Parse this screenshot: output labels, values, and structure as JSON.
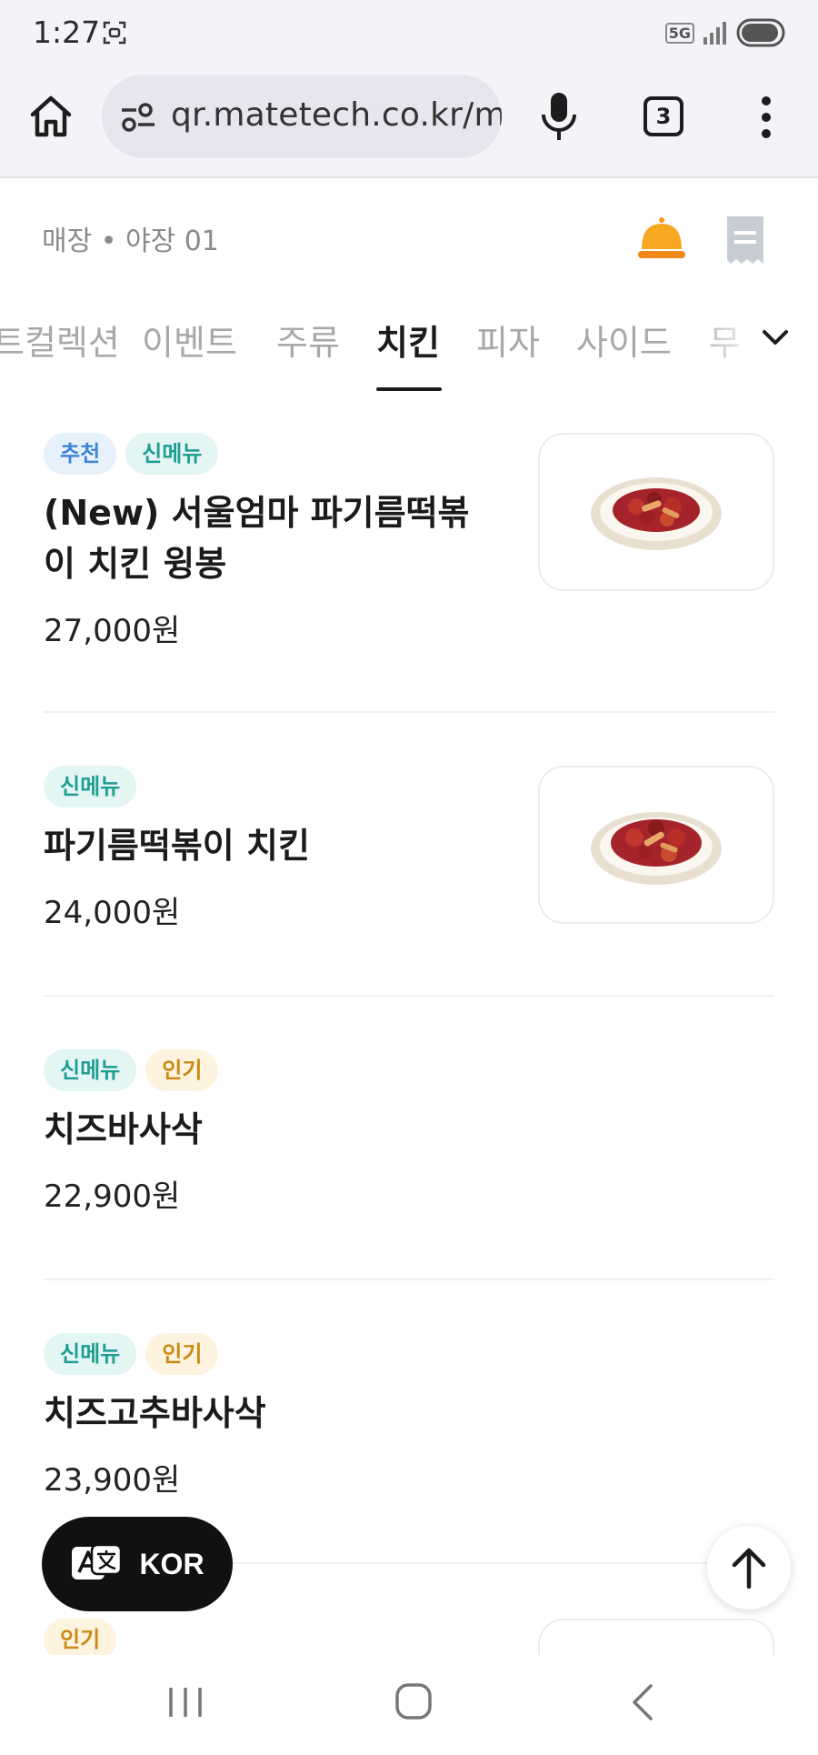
{
  "status_bar": {
    "time": "1:27",
    "network": "5G"
  },
  "browser": {
    "url": "qr.matetech.co.kr/me",
    "tab_count": "3"
  },
  "header": {
    "store": "매장 • 야장 01"
  },
  "categories": [
    "트컬렉션",
    "이벤트",
    "주류",
    "치킨",
    "피자",
    "사이드",
    "무"
  ],
  "active_category": "치킨",
  "items": [
    {
      "badges": [
        "추천",
        "신메뉴"
      ],
      "name": "(New) 서울엄마 파기름떡볶이 치킨 윙봉",
      "price": "27,000원",
      "has_image": true
    },
    {
      "badges": [
        "신메뉴"
      ],
      "name": "파기름떡볶이 치킨",
      "price": "24,000원",
      "has_image": true
    },
    {
      "badges": [
        "신메뉴",
        "인기"
      ],
      "name": "치즈바사삭",
      "price": "22,900원",
      "has_image": false
    },
    {
      "badges": [
        "신메뉴",
        "인기"
      ],
      "name": "치즈고추바사삭",
      "price": "23,900원",
      "has_image": false
    },
    {
      "badges": [
        "인기"
      ],
      "name": "",
      "price": "",
      "has_image": true
    }
  ],
  "language_button": {
    "label": "KOR"
  },
  "colors": {
    "accent_bell": "#f59a1b",
    "badge_recommend": "#3f86d4",
    "badge_new": "#1f9e93",
    "badge_popular": "#c98a12"
  }
}
